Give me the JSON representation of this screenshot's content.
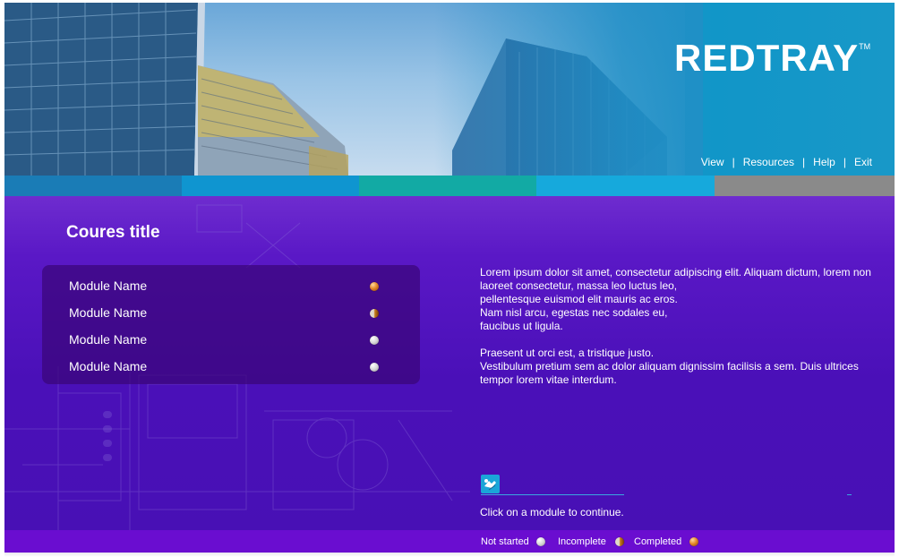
{
  "header": {
    "logo": "REDTRAY",
    "logo_tm": "TM",
    "nav": [
      "View",
      "Resources",
      "Help",
      "Exit"
    ]
  },
  "strip_colors": [
    "#1a7cb6",
    "#0f95d0",
    "#12aaa4",
    "#16a9dc",
    "#8a8a8a"
  ],
  "course": {
    "title": "Coures title",
    "modules": [
      {
        "name": "Module Name",
        "status": "completed"
      },
      {
        "name": "Module Name",
        "status": "incomplete"
      },
      {
        "name": "Module Name",
        "status": "notstarted"
      },
      {
        "name": "Module Name",
        "status": "notstarted"
      }
    ]
  },
  "description": {
    "para1": [
      "Lorem ipsum dolor sit amet, consectetur adipiscing elit. Aliquam dictum, lorem non laoreet consectetur, massa leo luctus leo,",
      "pellentesque euismod elit mauris ac eros.",
      "Nam nisl arcu, egestas nec sodales eu,",
      "faucibus ut ligula."
    ],
    "para2": [
      "Praesent ut orci est, a tristique justo.",
      "Vestibulum pretium sem ac dolor aliquam dignissim facilisis a sem. Duis ultrices tempor lorem vitae interdum."
    ]
  },
  "hint": {
    "icon": "touch-hand-icon",
    "text": "Click on a module to continue."
  },
  "legend": {
    "not_started": "Not started",
    "incomplete": "Incomplete",
    "completed": "Completed"
  },
  "colors": {
    "main_purple": "#4a10b8",
    "legend_purple": "#6a0dd0",
    "header_blue": "#1f8fc6"
  }
}
